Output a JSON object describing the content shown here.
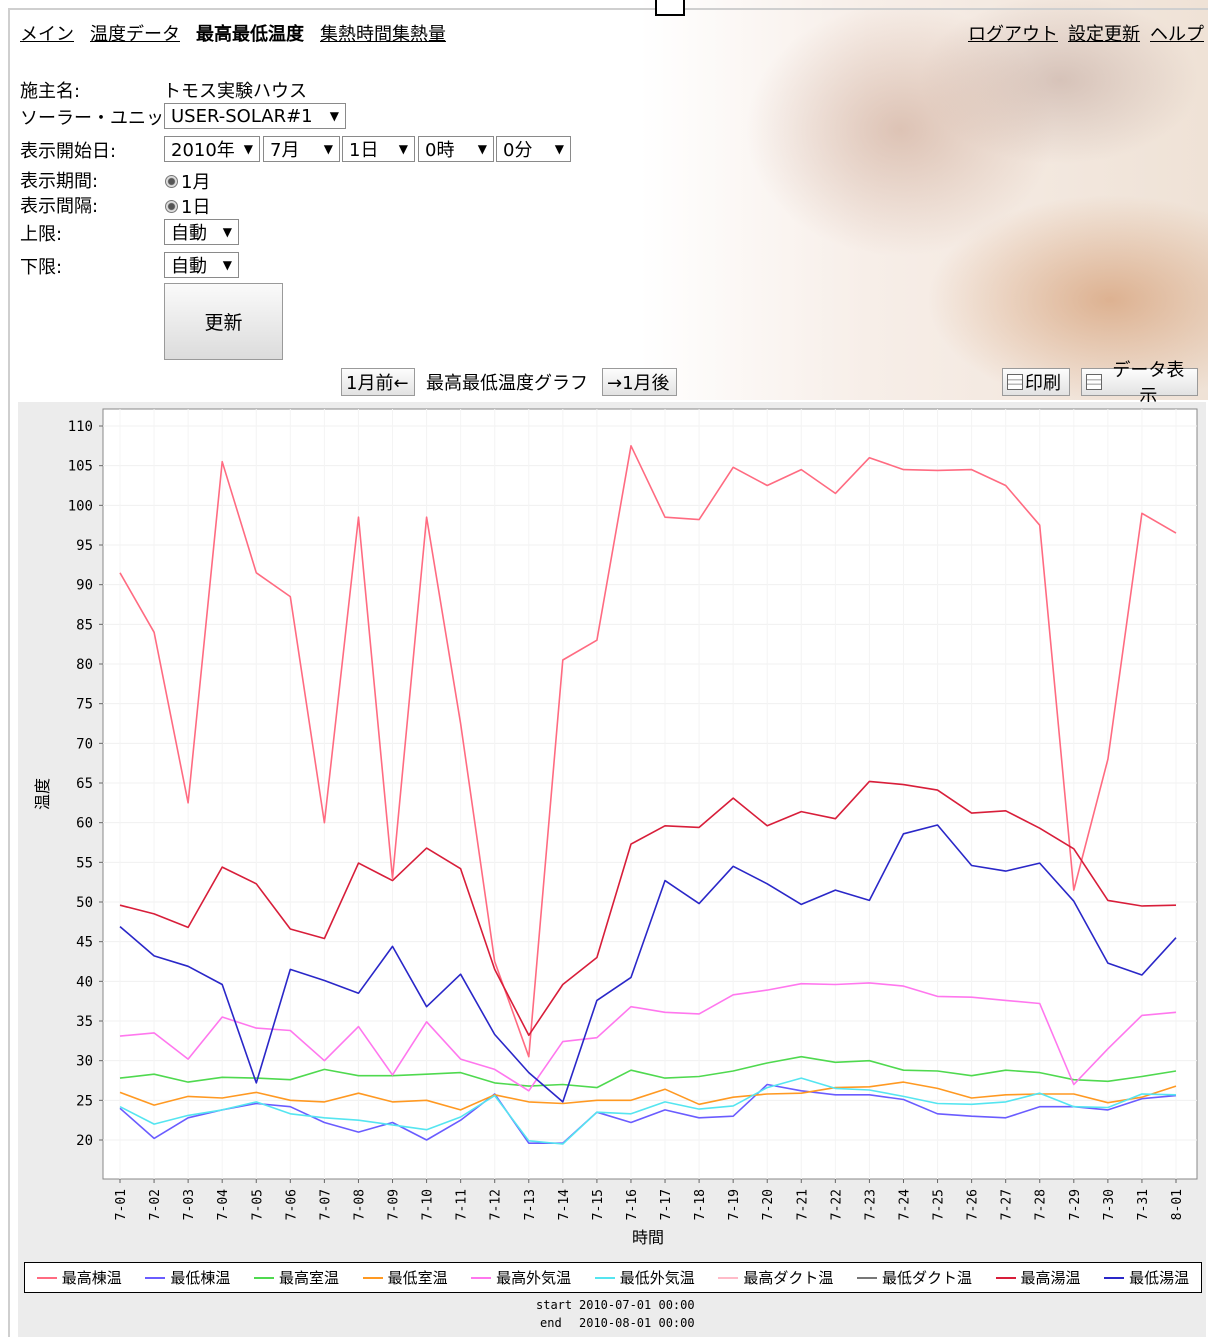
{
  "nav": {
    "items": [
      "メイン",
      "温度データ",
      "最高最低温度",
      "集熱時間集熱量"
    ],
    "current_index": 2
  },
  "toplinks": [
    "ログアウト",
    "設定更新",
    "ヘルプ"
  ],
  "form": {
    "owner_label": "施主名:",
    "owner_value": "トモス実験ハウス",
    "unit_label": "ソーラー・ユニット:",
    "unit_value": "USER-SOLAR#1",
    "start_label": "表示開始日:",
    "start_year": "2010年",
    "start_month": "7月",
    "start_day": "1日",
    "start_hour": "0時",
    "start_minute": "0分",
    "period_label": "表示期間:",
    "period_value": "1月",
    "interval_label": "表示間隔:",
    "interval_value": "1日",
    "upper_label": "上限:",
    "upper_value": "自動",
    "lower_label": "下限:",
    "lower_value": "自動",
    "update_button": "更新"
  },
  "toolbar": {
    "prev_button": "1月前←",
    "graph_title": "最高最低温度グラフ",
    "next_button": "→1月後",
    "print_button": "印刷",
    "data_button": "データ表示"
  },
  "footer": {
    "start_label": "start",
    "start_value": "2010-07-01 00:00",
    "end_label": "end",
    "end_value": "2010-08-01 00:00"
  },
  "chart_data": {
    "type": "line",
    "title": "",
    "xlabel": "時間",
    "ylabel": "温度",
    "ylim": [
      20,
      110
    ],
    "yticks": [
      20,
      25,
      30,
      35,
      40,
      45,
      50,
      55,
      60,
      65,
      70,
      75,
      80,
      85,
      90,
      95,
      100,
      105,
      110
    ],
    "grid": true,
    "legend_position": "bottom",
    "categories": [
      "7-01",
      "7-02",
      "7-03",
      "7-04",
      "7-05",
      "7-06",
      "7-07",
      "7-08",
      "7-09",
      "7-10",
      "7-11",
      "7-12",
      "7-13",
      "7-14",
      "7-15",
      "7-16",
      "7-17",
      "7-18",
      "7-19",
      "7-20",
      "7-21",
      "7-22",
      "7-23",
      "7-24",
      "7-25",
      "7-26",
      "7-27",
      "7-28",
      "7-29",
      "7-30",
      "7-31",
      "8-01"
    ],
    "series": [
      {
        "name": "最高棟温",
        "color": "#ff6b81",
        "values": [
          91.5,
          84,
          62.5,
          105.5,
          91.5,
          88.5,
          60,
          98.5,
          53,
          98.5,
          72.5,
          42.5,
          30.5,
          80.5,
          83,
          107.5,
          98.5,
          98.2,
          104.8,
          102.5,
          104.5,
          101.5,
          106,
          104.5,
          104.4,
          104.5,
          102.5,
          97.5,
          51.5,
          68,
          99,
          96.5
        ]
      },
      {
        "name": "最低棟温",
        "color": "#6a5cff",
        "values": [
          24,
          20.2,
          22.8,
          23.8,
          24.6,
          24.2,
          22.2,
          21,
          22.2,
          20,
          22.5,
          25.8,
          19.6,
          19.6,
          23.5,
          22.2,
          23.8,
          22.8,
          23,
          27,
          26.2,
          25.7,
          25.7,
          25.1,
          23.3,
          23,
          22.8,
          24.2,
          24.2,
          23.8,
          25.2,
          25.6
        ]
      },
      {
        "name": "最高室温",
        "color": "#4fd94f",
        "values": [
          27.8,
          28.3,
          27.3,
          27.9,
          27.8,
          27.6,
          28.9,
          28.1,
          28.1,
          28.3,
          28.5,
          27.2,
          26.8,
          27,
          26.6,
          28.8,
          27.8,
          28,
          28.7,
          29.7,
          30.5,
          29.8,
          30,
          28.8,
          28.7,
          28.1,
          28.8,
          28.5,
          27.6,
          27.4,
          28,
          28.7
        ]
      },
      {
        "name": "最低室温",
        "color": "#ff9922",
        "values": [
          26,
          24.4,
          25.5,
          25.3,
          26,
          25,
          24.8,
          25.9,
          24.8,
          25,
          23.8,
          25.7,
          24.8,
          24.6,
          25,
          25,
          26.4,
          24.5,
          25.4,
          25.8,
          25.9,
          26.6,
          26.7,
          27.3,
          26.5,
          25.3,
          25.7,
          25.8,
          25.8,
          24.7,
          25.4,
          26.8
        ]
      },
      {
        "name": "最高外気温",
        "color": "#ff77ee",
        "values": [
          33.1,
          33.5,
          30.2,
          35.5,
          34.1,
          33.8,
          30,
          34.3,
          28.2,
          34.9,
          30.2,
          28.9,
          26.2,
          32.4,
          32.9,
          36.8,
          36.1,
          35.9,
          38.3,
          38.9,
          39.7,
          39.6,
          39.8,
          39.4,
          38.1,
          38,
          37.6,
          37.2,
          27,
          31.5,
          35.7,
          36.1
        ]
      },
      {
        "name": "最低外気温",
        "color": "#55e5f0",
        "values": [
          24.2,
          22,
          23.1,
          23.8,
          24.8,
          23.3,
          22.8,
          22.5,
          21.9,
          21.3,
          22.9,
          25.6,
          19.9,
          19.5,
          23.5,
          23.3,
          24.8,
          23.9,
          24.3,
          26.6,
          27.8,
          26.5,
          26.3,
          25.5,
          24.6,
          24.5,
          24.8,
          25.9,
          24.2,
          24.1,
          25.8,
          25.7
        ]
      },
      {
        "name": "最高ダクト温",
        "color": "#ffbbc8",
        "values": []
      },
      {
        "name": "最低ダクト温",
        "color": "#777777",
        "values": []
      },
      {
        "name": "最高湯温",
        "color": "#d81e3a",
        "values": [
          49.6,
          48.5,
          46.8,
          54.4,
          52.3,
          46.6,
          45.4,
          54.9,
          52.7,
          56.8,
          54.2,
          41.5,
          33.2,
          39.6,
          43,
          57.3,
          59.6,
          59.4,
          63.1,
          59.6,
          61.4,
          60.5,
          65.2,
          64.8,
          64.1,
          61.2,
          61.5,
          59.3,
          56.7,
          50.2,
          49.5,
          49.6
        ]
      },
      {
        "name": "最低湯温",
        "color": "#2a27c8",
        "values": [
          46.9,
          43.2,
          41.9,
          39.6,
          27.2,
          41.5,
          40.1,
          38.5,
          44.4,
          36.8,
          40.9,
          33.3,
          28.5,
          24.8,
          37.6,
          40.5,
          52.7,
          49.8,
          54.5,
          52.3,
          49.7,
          51.5,
          50.2,
          58.6,
          59.7,
          54.6,
          53.9,
          54.9,
          50.1,
          42.3,
          40.8,
          45.5
        ]
      }
    ]
  }
}
